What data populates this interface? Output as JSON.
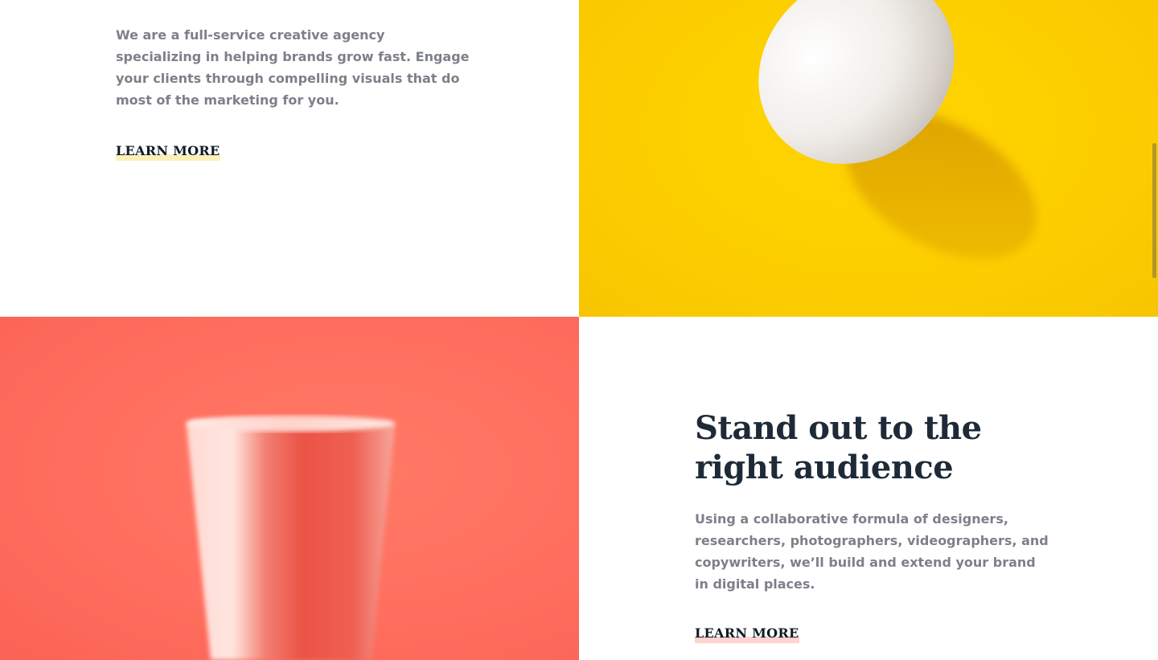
{
  "section_one": {
    "description": "We are a full-service creative agency specializing in helping brands grow fast. Engage your clients through compelling visuals that do most of the marketing for you.",
    "cta_label": "LEARN MORE",
    "cta_highlight_color": "#fdf0b6",
    "image_background": "#fcce00"
  },
  "section_two": {
    "heading": "Stand out to the right audience",
    "description": "Using a collaborative formula of designers, researchers, photographers, videographers, and copywriters, we’ll build and extend your brand in digital places.",
    "cta_label": "LEARN MORE",
    "cta_highlight_color": "#ffd3cf",
    "image_background": "#ff6e5e"
  }
}
